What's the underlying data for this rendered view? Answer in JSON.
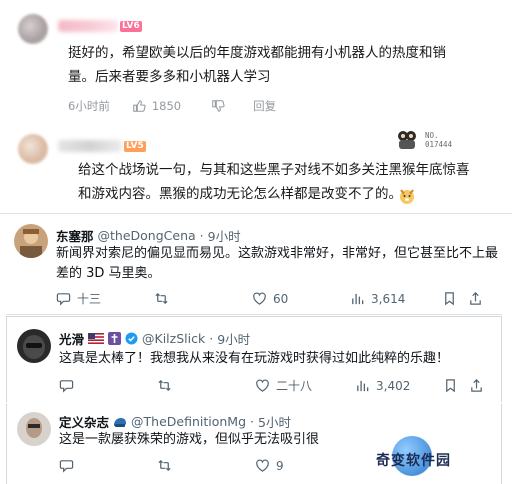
{
  "bili_comments": [
    {
      "level": "LV6",
      "text_line1": "挺好的，希望欧美以后的年度游戏都能拥有小机器人的热度和销",
      "text_line2": "量。后来者要多多和小机器人学习",
      "time": "6小时前",
      "likes": "1850",
      "reply_label": "回复"
    },
    {
      "level": "LV5",
      "badge_text_line1": "NO.",
      "badge_text_line2": "017444",
      "text_line1": "给这个战场说一句，与其和这些黑子对线不如多关注黑猴年底惊喜",
      "text_line2": "和游戏内容。黑猴的成功无论怎么样都是改变不了的。"
    }
  ],
  "tweets": [
    {
      "name": "东塞那",
      "handle": "@theDongCena",
      "dot": "·",
      "time": "9小时",
      "text_line1": "新闻界对索尼的偏见显而易见。这款游戏非常好，非常好，但它甚至比不上最",
      "text_line2": "差的 3D 马里奥。",
      "replies": "十三",
      "retweets": "",
      "likes": "60",
      "views": "3,614"
    },
    {
      "name": "光滑",
      "handle": "@KilzSlick",
      "dot": "·",
      "time": "9小时",
      "text_line1": "这真是太棒了！我想我从来没有在玩游戏时获得过如此纯粹的乐趣！",
      "replies": "",
      "retweets": "",
      "likes": "二十八",
      "views": "3,402"
    },
    {
      "name": "定义杂志",
      "handle": "@TheDefinitionMg",
      "dot": "·",
      "time": "5小时",
      "text_line1": "这是一款屡获殊荣的游戏，但似乎无法吸引很",
      "replies": "",
      "retweets": "",
      "likes": "9"
    }
  ],
  "watermark": "奇变软件园",
  "colors": {
    "bili_pink": "#fb7299",
    "twitter_gray": "#536471",
    "verified_blue": "#1d9bf0"
  },
  "icons": [
    "thumb-up-icon",
    "thumb-down-icon",
    "reply-icon",
    "retweet-icon",
    "heart-icon",
    "views-icon",
    "bookmark-icon",
    "share-icon",
    "verified-icon",
    "flag-icon",
    "cross-icon",
    "dog-emoji-icon"
  ]
}
